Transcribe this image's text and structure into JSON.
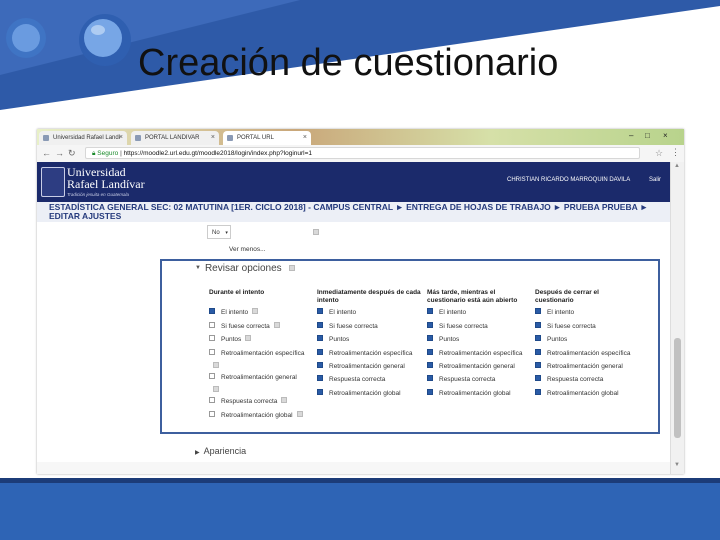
{
  "slide": {
    "title": "Creación de cuestionario",
    "colors": {
      "band": "#2e64b5",
      "band_dark": "#1c3c78"
    }
  },
  "browser": {
    "tabs": [
      {
        "label": "Universidad Rafael Landi"
      },
      {
        "label": "PORTAL LANDIVAR"
      },
      {
        "label": "PORTAL URL"
      }
    ],
    "url": {
      "secure_label": "Seguro",
      "text": "https://moodle2.url.edu.gt/moodle2018/login/index.php?loginurl=1"
    }
  },
  "site": {
    "logo_line1": "Universidad",
    "logo_line2": "Rafael Landívar",
    "logo_tagline": "Tradición jesuita en Guatemala",
    "user": "CHRISTIAN RICARDO MARROQUIN DAVILA",
    "logout": "Salir",
    "breadcrumb": "ESTADÍSTICA GENERAL SEC: 02 MATUTINA [1ER. CICLO 2018] - CAMPUS CENTRAL ► ENTREGA DE HOJAS DE TRABAJO ► PRUEBA PRUEBA ► EDITAR AJUSTES",
    "colors": {
      "header": "#1b2a6b",
      "checkbox": "#2a5ba6"
    }
  },
  "content": {
    "select_value": "No",
    "ver_menos": "Ver menos...",
    "section_title": "Revisar opciones",
    "collapsed_section": "Apariencia",
    "columns": [
      {
        "heading": "Durante el intento",
        "options": [
          {
            "label": "El intento",
            "checked": true
          },
          {
            "label": "Si fuese correcta",
            "checked": false
          },
          {
            "label": "Puntos",
            "checked": false
          },
          {
            "label": "Retroalimentación específica",
            "checked": false
          },
          {
            "label": "Retroalimentación general",
            "checked": false
          },
          {
            "label": "Respuesta correcta",
            "checked": false
          },
          {
            "label": "Retroalimentación global",
            "checked": false
          }
        ]
      },
      {
        "heading": "Inmediatamente después de cada intento",
        "options": [
          {
            "label": "El intento",
            "checked": true
          },
          {
            "label": "Si fuese correcta",
            "checked": true
          },
          {
            "label": "Puntos",
            "checked": true
          },
          {
            "label": "Retroalimentación específica",
            "checked": true
          },
          {
            "label": "Retroalimentación general",
            "checked": true
          },
          {
            "label": "Respuesta correcta",
            "checked": true
          },
          {
            "label": "Retroalimentación global",
            "checked": true
          }
        ]
      },
      {
        "heading": "Más tarde, mientras el cuestionario está aún abierto",
        "options": [
          {
            "label": "El intento",
            "checked": true
          },
          {
            "label": "Si fuese correcta",
            "checked": true
          },
          {
            "label": "Puntos",
            "checked": true
          },
          {
            "label": "Retroalimentación específica",
            "checked": true
          },
          {
            "label": "Retroalimentación general",
            "checked": true
          },
          {
            "label": "Respuesta correcta",
            "checked": true
          },
          {
            "label": "Retroalimentación global",
            "checked": true
          }
        ]
      },
      {
        "heading": "Después de cerrar el cuestionario",
        "options": [
          {
            "label": "El intento",
            "checked": true
          },
          {
            "label": "Si fuese correcta",
            "checked": true
          },
          {
            "label": "Puntos",
            "checked": true
          },
          {
            "label": "Retroalimentación específica",
            "checked": true
          },
          {
            "label": "Retroalimentación general",
            "checked": true
          },
          {
            "label": "Respuesta correcta",
            "checked": true
          },
          {
            "label": "Retroalimentación global",
            "checked": true
          }
        ]
      }
    ]
  }
}
